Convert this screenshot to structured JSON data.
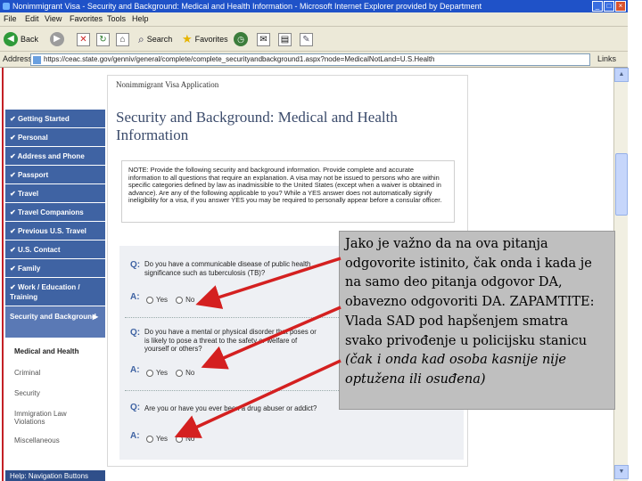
{
  "window": {
    "title": "Nonimmigrant Visa - Security and Background: Medical and Health Information - Microsoft Internet Explorer provided by Department"
  },
  "menu": [
    "File",
    "Edit",
    "View",
    "Favorites",
    "Tools",
    "Help"
  ],
  "toolbar": {
    "back": "Back",
    "search": "Search",
    "favorites": "Favorites"
  },
  "address": {
    "label": "Address",
    "url": "https://ceac.state.gov/genniv/general/complete/complete_securityandbackground1.aspx?node=MedicalNotLand=U.S.Health",
    "links": "Links"
  },
  "page": {
    "app_heading": "Nonimmigrant Visa Application",
    "title": "Security and Background: Medical and Health Information",
    "note": "NOTE: Provide the following security and background information. Provide complete and accurate information to all questions that require an explanation. A visa may not be issued to persons who are within specific categories defined by law as inadmissible to the United States (except when a waiver is obtained in advance). Are any of the following applicable to you? While a YES answer does not automatically signify ineligibility for a visa, if you answer YES you may be required to personally appear before a consular officer."
  },
  "sidebar": {
    "items": [
      "Getting Started",
      "Personal",
      "Address and Phone",
      "Passport",
      "Travel",
      "Travel Companions",
      "Previous U.S. Travel",
      "U.S. Contact",
      "Family",
      "Work / Education / Training"
    ],
    "active": "Security and Background",
    "sub_items": [
      "Medical and Health",
      "Criminal",
      "Security",
      "Immigration Law Violations",
      "Miscellaneous"
    ],
    "bottom": "Help: Navigation Buttons"
  },
  "questions": {
    "q_label": "Q:",
    "a_label": "A:",
    "yes": "Yes",
    "no": "No",
    "q1": "Do you have a communicable disease of public health significance such as tuberculosis (TB)?",
    "q2": "Do you have a mental or physical disorder that poses or is likely to pose a threat to the safety or welfare of yourself or others?",
    "q3": "Are you or have you ever been a drug abuser or addict?"
  },
  "callout": {
    "main": "Jako je važno da na ova pitanja odgovorite istinito, čak onda i kada je na samo deo pitanja odgovor DA, obavezno odgovoriti DA.  ZAPAMTITE: Vlada SAD pod hapšenjem smatra svako privođenje u policijsku stanicu",
    "italic": "(čak i onda kad osoba kasnije nije optužena ili osuđena)"
  },
  "colors": {
    "title_bar": "#1f52c8",
    "sidebar": "#3f63a3",
    "arrow": "#d42020",
    "callout_bg": "#bfbfbf"
  }
}
